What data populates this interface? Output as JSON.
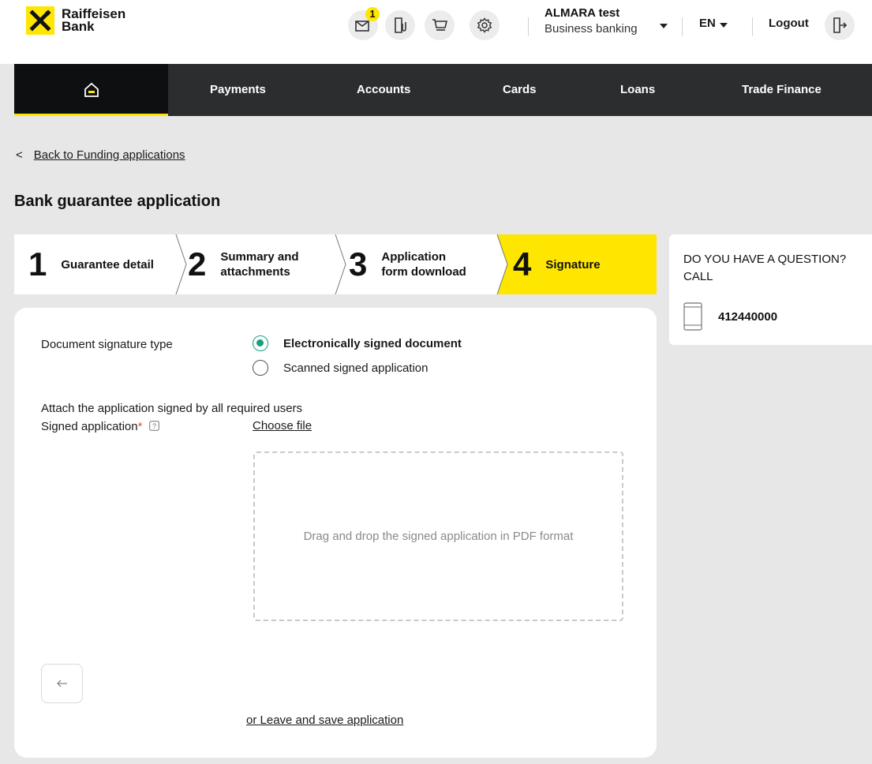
{
  "header": {
    "brand_line1": "Raiffeisen",
    "brand_line2": "Bank",
    "brand_color": "#fee600",
    "icons": [
      "mail-icon",
      "document-clip-icon",
      "cart-icon",
      "gear-icon"
    ],
    "unread_messages": "1",
    "account_name": "ALMARA test",
    "account_type": "Business banking",
    "language": "EN",
    "logout_label": "Logout"
  },
  "nav": {
    "home_icon": "home-icon",
    "items": [
      {
        "label": "Payments"
      },
      {
        "label": "Accounts"
      },
      {
        "label": "Cards"
      },
      {
        "label": "Loans"
      },
      {
        "label": "Trade Finance"
      }
    ],
    "active": "home",
    "bg_color": "#2b2d2e",
    "accent_color": "#fee600"
  },
  "page": {
    "back_chevron": "<",
    "back_label": "Back to Funding applications",
    "title": "Bank guarantee application"
  },
  "stepper": {
    "steps": [
      {
        "number": "1",
        "label": "Guarantee detail",
        "active": false
      },
      {
        "number": "2",
        "label": "Summary and attachments",
        "active": false
      },
      {
        "number": "3",
        "label": "Application form download",
        "active": false
      },
      {
        "number": "4",
        "label": "Signature",
        "active": true
      }
    ],
    "active_color": "#fee600"
  },
  "help": {
    "question": "DO YOU HAVE A QUESTION? CALL",
    "phone_icon": "mobile-phone-icon",
    "phone": "412440000"
  },
  "form": {
    "signature_type_label": "Document signature type",
    "options": [
      {
        "label": "Electronically signed document",
        "selected": true
      },
      {
        "label": "Scanned signed application",
        "selected": false
      }
    ],
    "radio_color": "#1a9e80",
    "attach_instruction": "Attach the application signed by all required users",
    "signed_app_label": "Signed application",
    "required_mark": "*",
    "info_icon": "help-tooltip-icon",
    "choose_file_label": "Choose file",
    "dropzone_text": "Drag and drop the signed application in PDF format",
    "back_button_icon": "arrow-left-icon",
    "leave_link": "or Leave and save application"
  }
}
